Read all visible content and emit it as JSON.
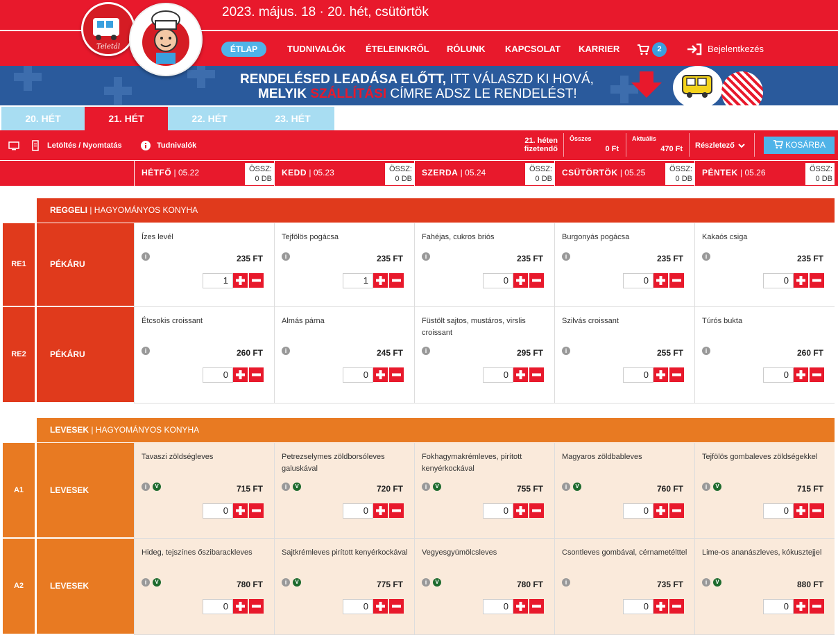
{
  "header": {
    "date": "2023. május. 18  ·  20. hét, csütörtök",
    "nav": {
      "etlap": "ÉTLAP",
      "tudnivalok": "TUDNIVALÓK",
      "eteleinkrol": "ÉTELEINKRŐL",
      "rolunk": "RÓLUNK",
      "kapcsolat": "KAPCSOLAT",
      "karrier": "KARRIER",
      "cart_count": "2",
      "login": "Bejelentkezés"
    },
    "logo_text": "Teletál"
  },
  "banner": {
    "line1_bold": "RENDELÉSED LEADÁSA ELŐTT,",
    "line1_thin": " ITT VÁLASZD KI HOVÁ,",
    "line2_bold": "MELYIK ",
    "line2_red": "SZÁLLÍTÁSI",
    "line2_thin": " CÍMRE ADSZ LE RENDELÉST!"
  },
  "week_tabs": [
    "20. HÉT",
    "21. HÉT",
    "22. HÉT",
    "23. HÉT"
  ],
  "active_week": "21. HÉT",
  "toolbar": {
    "download": "Letöltés / Nyomtatás",
    "info": "Tudnivalók",
    "payable_label": "21. héten fizetendő",
    "total_label": "Összes",
    "total_value": "0 Ft",
    "current_label": "Aktuális",
    "current_value": "470 Ft",
    "details": "Részletező",
    "cart_button": "KOSÁRBA"
  },
  "days": [
    {
      "name": "HÉTFŐ",
      "date": "05.22",
      "sum_label": "ÖSSZ:",
      "sum": "0 DB"
    },
    {
      "name": "KEDD",
      "date": "05.23",
      "sum_label": "ÖSSZ:",
      "sum": "0 DB"
    },
    {
      "name": "SZERDA",
      "date": "05.24",
      "sum_label": "ÖSSZ:",
      "sum": "0 DB"
    },
    {
      "name": "CSÜTÖRTÖK",
      "date": "05.25",
      "sum_label": "ÖSSZ:",
      "sum": "0 DB"
    },
    {
      "name": "PÉNTEK",
      "date": "05.26",
      "sum_label": "ÖSSZ:",
      "sum": "0 DB"
    }
  ],
  "sections": [
    {
      "title_bold": "REGGELI",
      "title_rest": " | HAGYOMÁNYOS KONYHA",
      "color": "#e03a1c",
      "cell_bg": "#ffffff",
      "rows": [
        {
          "code": "RE1",
          "category": "PÉKÁRU",
          "items": [
            {
              "name": "Ízes levél",
              "price": "235 FT",
              "qty": "1",
              "veg": false
            },
            {
              "name": "Tejfölös pogácsa",
              "price": "235 FT",
              "qty": "1",
              "veg": false
            },
            {
              "name": "Fahéjas, cukros briós",
              "price": "235 FT",
              "qty": "0",
              "veg": false
            },
            {
              "name": "Burgonyás pogácsa",
              "price": "235 FT",
              "qty": "0",
              "veg": false
            },
            {
              "name": "Kakaós csiga",
              "price": "235 FT",
              "qty": "0",
              "veg": false
            }
          ]
        },
        {
          "code": "RE2",
          "category": "PÉKÁRU",
          "items": [
            {
              "name": "Étcsokis croissant",
              "price": "260 FT",
              "qty": "0",
              "veg": false
            },
            {
              "name": "Almás párna",
              "price": "245 FT",
              "qty": "0",
              "veg": false
            },
            {
              "name": "Füstölt sajtos, mustáros, virslis croissant",
              "price": "295 FT",
              "qty": "0",
              "veg": false
            },
            {
              "name": "Szilvás croissant",
              "price": "255 FT",
              "qty": "0",
              "veg": false
            },
            {
              "name": "Túrós bukta",
              "price": "260 FT",
              "qty": "0",
              "veg": false
            }
          ]
        }
      ]
    },
    {
      "title_bold": "LEVESEK",
      "title_rest": " | HAGYOMÁNYOS KONYHA",
      "color": "#e87a22",
      "cell_bg": "#faeadb",
      "rows": [
        {
          "code": "A1",
          "category": "LEVESEK",
          "items": [
            {
              "name": "Tavaszi zöldségleves",
              "price": "715 FT",
              "qty": "0",
              "veg": true
            },
            {
              "name": "Petrezselymes zöldborsóleves galuskával",
              "price": "720 FT",
              "qty": "0",
              "veg": true
            },
            {
              "name": "Fokhagymakrémleves, pirított kenyérkockával",
              "price": "755 FT",
              "qty": "0",
              "veg": true
            },
            {
              "name": "Magyaros zöldbableves",
              "price": "760 FT",
              "qty": "0",
              "veg": true
            },
            {
              "name": "Tejfölös gombaleves zöldségekkel",
              "price": "715 FT",
              "qty": "0",
              "veg": true
            }
          ]
        },
        {
          "code": "A2",
          "category": "LEVESEK",
          "items": [
            {
              "name": "Hideg, tejszínes őszibarackleves",
              "price": "780 FT",
              "qty": "0",
              "veg": true
            },
            {
              "name": "Sajtkrémleves pirított kenyérkockával",
              "price": "775 FT",
              "qty": "0",
              "veg": true
            },
            {
              "name": "Vegyesgyümölcsleves",
              "price": "780 FT",
              "qty": "0",
              "veg": true
            },
            {
              "name": "Csontleves gombával, cérnametélttel",
              "price": "735 FT",
              "qty": "0",
              "veg": false
            },
            {
              "name": "Lime-os ananászleves, kókusztejjel",
              "price": "880 FT",
              "qty": "0",
              "veg": true
            }
          ]
        }
      ]
    }
  ],
  "icons": {
    "info": "i",
    "vegetarian": "V"
  }
}
